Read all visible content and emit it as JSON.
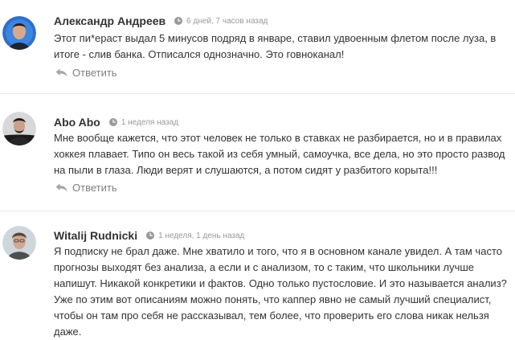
{
  "comments": [
    {
      "author": "Александр Андреев",
      "time": "6 дней, 7 часов назад",
      "text": "Этот пи*ераст выдал 5 минусов подряд в январе, ставил удвоенным флетом после луза, в итоге - слив банка. Отписался однозначно. Это говноканал!",
      "reply_label": "Ответить"
    },
    {
      "author": "Abo Abo",
      "time": "1 неделя назад",
      "text": "Мне вообще кажется, что этот человек не только в ставках не разбирается, но и в правилах хоккея плавает. Типо он весь такой из себя умный, самоучка, все дела, но это просто развод на пыли в глаза. Люди верят и слушаются, а потом сидят у разбитого корыта!!!",
      "reply_label": "Ответить"
    },
    {
      "author": "Witalij Rudnicki",
      "time": "1 неделя, 1 день назад",
      "text": "Я подписку не брал даже. Мне хватило и того, что я в основном канале увидел. А там часто прогнозы выходят без анализа, а если и с анализом, то с таким, что школьники лучше напишут. Никакой конкретики и фактов. Одно только пустословие. И это называется анализ? Уже по этим вот описаниям можно понять, что каппер явно не самый лучший специалист, чтобы он там про себя не рассказывал, тем более, что проверить его слова никак нельзя даже.",
      "reply_label": ""
    }
  ],
  "icons": {
    "time": "clock-icon",
    "reply": "reply-arrow-icon"
  },
  "colors": {
    "author": "#333333",
    "text": "#333333",
    "muted": "#999999",
    "reply": "#808080"
  }
}
